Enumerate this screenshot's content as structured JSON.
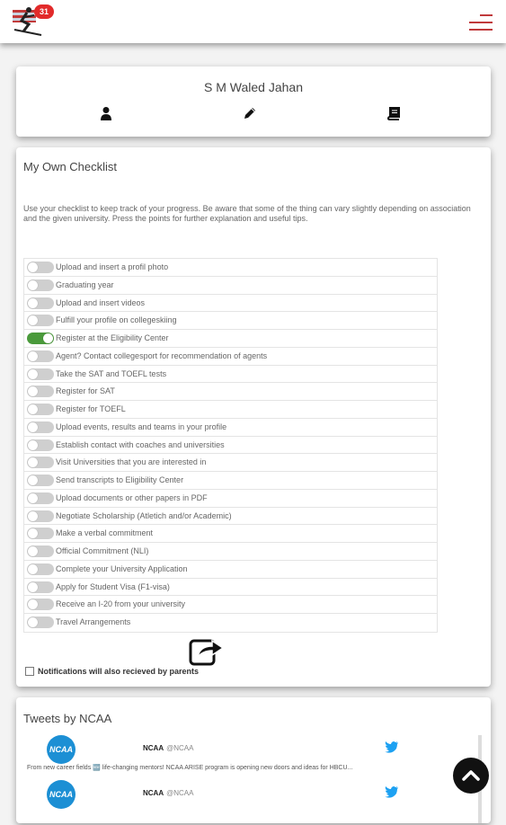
{
  "header": {
    "logo_icon": "skier-flag-logo-icon",
    "badge_count": "31",
    "menu_icon": "hamburger-menu-icon",
    "accent_color": "#c0393b"
  },
  "profile": {
    "name": "S M Waled Jahan",
    "icons": [
      "user-icon",
      "pencil-icon",
      "book-icon"
    ]
  },
  "checklist": {
    "title": "My Own Checklist",
    "description": "Use your checklist to keep track of your progress. Be aware that some of the thing can vary slightly depending on association and the given university. Press the points for further explanation and useful tips.",
    "on_color": "#4a9a3b",
    "items": [
      {
        "label": "Upload and insert a profil photo",
        "on": false
      },
      {
        "label": "Graduating year",
        "on": false
      },
      {
        "label": "Upload and insert videos",
        "on": false
      },
      {
        "label": "Fulfill your profile on collegeskiing",
        "on": false
      },
      {
        "label": "Register at the Eligibility Center",
        "on": true
      },
      {
        "label": "Agent? Contact collegesport for recommendation of agents",
        "on": false
      },
      {
        "label": "Take the SAT and TOEFL tests",
        "on": false
      },
      {
        "label": "Register for SAT",
        "on": false
      },
      {
        "label": "Register for TOEFL",
        "on": false
      },
      {
        "label": "Upload events, results and teams in your profile",
        "on": false
      },
      {
        "label": "Establish contact with coaches and universities",
        "on": false
      },
      {
        "label": "Visit Universities that you are interested in",
        "on": false
      },
      {
        "label": "Send transcripts to Eligibility Center",
        "on": false
      },
      {
        "label": "Upload documents or other papers in PDF",
        "on": false
      },
      {
        "label": "Negotiate Scholarship (Atletich and/or Academic)",
        "on": false
      },
      {
        "label": "Make a verbal commitment",
        "on": false
      },
      {
        "label": "Official Commitment (NLI)",
        "on": false
      },
      {
        "label": "Complete your University Application",
        "on": false
      },
      {
        "label": "Apply for Student Visa (F1-visa)",
        "on": false
      },
      {
        "label": "Receive an I-20 from your university",
        "on": false
      },
      {
        "label": "Travel Arrangements",
        "on": false
      }
    ],
    "share_icon": "share-icon",
    "notification_label": "Notifications will also recieved by parents"
  },
  "tweets": {
    "title": "Tweets by NCAA",
    "items": [
      {
        "avatar_text": "NCAA",
        "name": "NCAA",
        "handle": "@NCAA",
        "text": "From new career fields 🆕 life-changing mentors! NCAA ARISE program is opening new doors and ideas for HBCU..."
      },
      {
        "avatar_text": "NCAA",
        "name": "NCAA",
        "handle": "@NCAA",
        "text": ""
      }
    ],
    "bird_color": "#1da1f2"
  },
  "fab": {
    "icon": "chevron-up-icon"
  }
}
